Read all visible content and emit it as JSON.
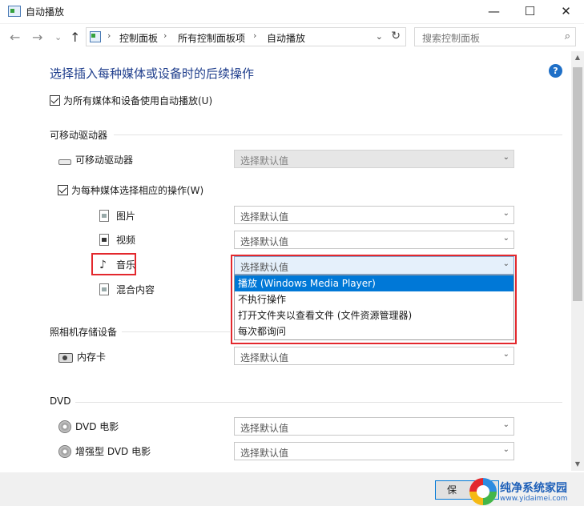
{
  "window": {
    "title": "自动播放",
    "controls": {
      "minimize": "—",
      "maximize": "☐",
      "close": "✕"
    }
  },
  "navigation": {
    "back": "←",
    "forward": "→",
    "recent": "⌄",
    "up": "↑"
  },
  "address_bar": {
    "breadcrumbs": [
      "控制面板",
      "所有控制面板项",
      "自动播放"
    ],
    "separator": "›",
    "refresh": "↻",
    "dropdown": "⌄"
  },
  "search": {
    "placeholder": "搜索控制面板",
    "icon": "⌕"
  },
  "main": {
    "heading": "选择插入每种媒体或设备时的后续操作",
    "help": "?",
    "use_autoplay_label": "为所有媒体和设备使用自动播放(U)",
    "use_autoplay_checked": true
  },
  "sections": {
    "removable": {
      "heading": "可移动驱动器",
      "drive_label": "可移动驱动器",
      "drive_value": "选择默认值",
      "per_media_label": "为每种媒体选择相应的操作(W)",
      "per_media_checked": true,
      "media": [
        {
          "label": "图片",
          "value": "选择默认值",
          "icon": "picture-file-icon"
        },
        {
          "label": "视频",
          "value": "选择默认值",
          "icon": "video-file-icon"
        },
        {
          "label": "音乐",
          "value": "选择默认值",
          "icon": "music-note-icon"
        },
        {
          "label": "混合内容",
          "value": "",
          "icon": "mixed-content-icon"
        }
      ]
    },
    "camera": {
      "heading": "照相机存储设备",
      "card_label": "内存卡",
      "card_value": "选择默认值"
    },
    "dvd": {
      "heading": "DVD",
      "movie_label": "DVD 电影",
      "movie_value": "选择默认值",
      "enhanced_label": "增强型 DVD 电影",
      "enhanced_value": "选择默认值"
    }
  },
  "music_dropdown": {
    "selected": "播放 (Windows Media Player)",
    "options": [
      "播放 (Windows Media Player)",
      "不执行操作",
      "打开文件夹以查看文件 (文件资源管理器)",
      "每次都询问"
    ]
  },
  "footer": {
    "save_label": "保"
  },
  "watermark": {
    "title": "纯净系统家园",
    "url": "www.yidaimei.com"
  },
  "scrollbar": {
    "up": "▲",
    "down": "▼"
  },
  "colors": {
    "heading": "#1e3d8c",
    "highlight": "#e3282d",
    "selection": "#0078d7"
  }
}
